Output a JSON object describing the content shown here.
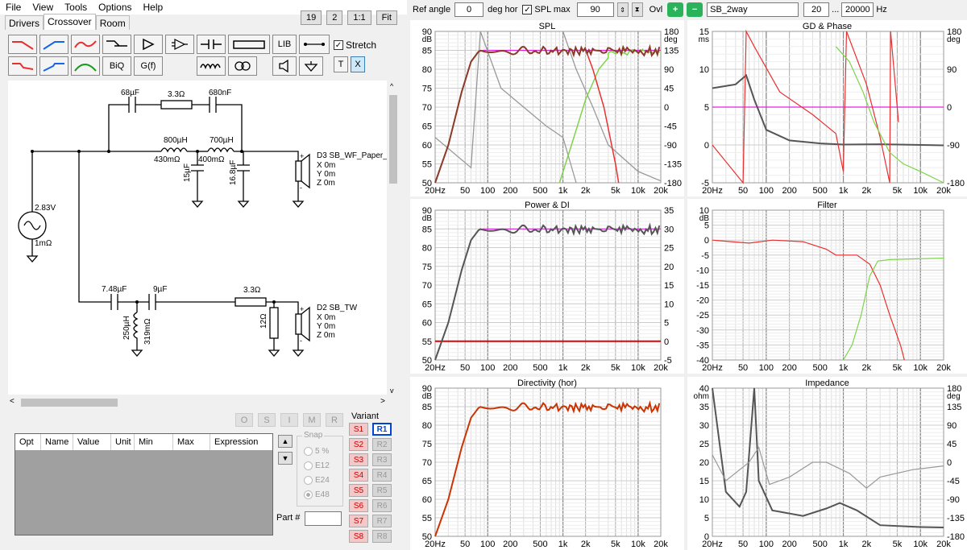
{
  "menu": [
    "File",
    "View",
    "Tools",
    "Options",
    "Help"
  ],
  "tabs": [
    "Drivers",
    "Crossover",
    "Room"
  ],
  "top_buttons": [
    "19",
    "2",
    "1:1",
    "Fit"
  ],
  "toolbar": {
    "biq": "BiQ",
    "gf": "G(f)",
    "lib": "LIB",
    "t": "T",
    "x": "X",
    "stretch_label": "Stretch",
    "stretch_checked": true
  },
  "schematic": {
    "c1": "68µF",
    "r1": "3.3Ω",
    "c2": "680nF",
    "l1": "800µH",
    "l1r": "430mΩ",
    "l2": "700µH",
    "l2r": "400mΩ",
    "c3": "15µF",
    "c4": "16.8µF",
    "d3": "D3 SB_WF_Paper_",
    "d3x": "X 0m",
    "d3y": "Y 0m",
    "d3z": "Z 0m",
    "src_v": "2.83V",
    "src_r": "1mΩ",
    "c5": "7.48µF",
    "c6": "9µF",
    "r2": "3.3Ω",
    "l3": "250µH",
    "l3r": "319mΩ",
    "r3": "12Ω",
    "d2": "D2 SB_TW",
    "d2x": "X 0m",
    "d2y": "Y 0m",
    "d2z": "Z 0m"
  },
  "osimr": [
    "O",
    "S",
    "I",
    "M",
    "R"
  ],
  "grid_headers": [
    "Opt",
    "Name",
    "Value",
    "Unit",
    "Min",
    "Max",
    "Expression"
  ],
  "snap": {
    "legend": "Snap",
    "options": [
      "5 %",
      "E12",
      "E24",
      "E48"
    ],
    "selected": "E48"
  },
  "part_label": "Part #",
  "variant": {
    "label": "Variant",
    "s": [
      "S1",
      "S2",
      "S3",
      "S4",
      "S5",
      "S6",
      "S7",
      "S8"
    ],
    "r": [
      "R1",
      "R2",
      "R3",
      "R4",
      "R5",
      "R6",
      "R7",
      "R8"
    ],
    "active": "R1"
  },
  "rtop": {
    "ref_angle_label": "Ref angle",
    "ref_angle": "0",
    "deg_hor": "deg hor",
    "spl_max_label": "SPL max",
    "spl_max": "90",
    "ovl": "Ovl",
    "name": "SB_2way",
    "fmin": "20",
    "dots": "...",
    "fmax": "20000",
    "hz": "Hz"
  },
  "colors": {
    "red": "#e83030",
    "green": "#7dd44a",
    "gray": "#555555",
    "lightgray": "#999999",
    "magenta": "#e020e0",
    "brown": "#8b3a2a",
    "darkred": "#cc3300"
  },
  "chart_data": [
    {
      "type": "line",
      "title": "SPL",
      "ylabel": "dB",
      "y2label": "deg",
      "ylim": [
        50,
        90
      ],
      "y2lim": [
        -180,
        180
      ],
      "yticks": [
        "90",
        "85",
        "80",
        "75",
        "70",
        "65",
        "60",
        "55",
        "50"
      ],
      "y2ticks": [
        "180",
        "135",
        "90",
        "45",
        "0",
        "-45",
        "-90",
        "-135",
        "-180"
      ],
      "xticks": [
        "20Hz",
        "50",
        "100",
        "200",
        "500",
        "1k",
        "2k",
        "5k",
        "10k",
        "20k"
      ],
      "series": [
        {
          "name": "",
          "values": [
            [
              20,
              50
            ],
            [
              40,
              70
            ],
            [
              70,
              84.5
            ],
            [
              100,
              84.8
            ],
            [
              200,
              84
            ],
            [
              300,
              85
            ],
            [
              500,
              84.5
            ],
            [
              700,
              86
            ],
            [
              1000,
              85
            ],
            [
              2000,
              84
            ],
            [
              4000,
              85
            ],
            [
              10000,
              84.5
            ],
            [
              20000,
              85
            ]
          ]
        }
      ]
    },
    {
      "type": "line",
      "title": "GD & Phase",
      "ylabel": "ms",
      "y2label": "deg",
      "ylim": [
        -5,
        15
      ],
      "yticks": [
        "15",
        "10",
        "5",
        "0",
        "-5"
      ],
      "y2ticks": [
        "180",
        "90",
        "0",
        "-90",
        "-180"
      ],
      "xticks": [
        "20Hz",
        "50",
        "100",
        "200",
        "500",
        "1k",
        "2k",
        "5k",
        "10k",
        "20k"
      ]
    },
    {
      "type": "line",
      "title": "Power & DI",
      "ylabel": "dB",
      "ylim": [
        50,
        90
      ],
      "y2lim": [
        -5,
        35
      ],
      "yticks": [
        "90",
        "85",
        "80",
        "75",
        "70",
        "65",
        "60",
        "55",
        "50"
      ],
      "y2ticks": [
        "35",
        "30",
        "25",
        "20",
        "15",
        "10",
        "5",
        "0",
        "-5"
      ],
      "xticks": [
        "20Hz",
        "50",
        "100",
        "200",
        "500",
        "1k",
        "2k",
        "5k",
        "10k",
        "20k"
      ]
    },
    {
      "type": "line",
      "title": "Filter",
      "ylabel": "dB",
      "ylim": [
        -40,
        10
      ],
      "yticks": [
        "10",
        "5",
        "0",
        "-5",
        "-10",
        "-15",
        "-20",
        "-25",
        "-30",
        "-35",
        "-40"
      ],
      "xticks": [
        "20Hz",
        "50",
        "100",
        "200",
        "500",
        "1k",
        "2k",
        "5k",
        "10k",
        "20k"
      ]
    },
    {
      "type": "line",
      "title": "Directivity (hor)",
      "ylabel": "dB",
      "ylim": [
        50,
        90
      ],
      "yticks": [
        "90",
        "85",
        "80",
        "75",
        "70",
        "65",
        "60",
        "55",
        "50"
      ],
      "xticks": [
        "20Hz",
        "50",
        "100",
        "200",
        "500",
        "1k",
        "2k",
        "5k",
        "10k",
        "20k"
      ]
    },
    {
      "type": "line",
      "title": "Impedance",
      "ylabel": "ohm",
      "y2label": "deg",
      "ylim": [
        0,
        40
      ],
      "yticks": [
        "40",
        "35",
        "30",
        "25",
        "20",
        "15",
        "10",
        "5",
        "0"
      ],
      "y2ticks": [
        "180",
        "135",
        "90",
        "45",
        "0",
        "-45",
        "-90",
        "-135",
        "-180"
      ],
      "xticks": [
        "20Hz",
        "50",
        "100",
        "200",
        "500",
        "1k",
        "2k",
        "5k",
        "10k",
        "20k"
      ]
    }
  ]
}
